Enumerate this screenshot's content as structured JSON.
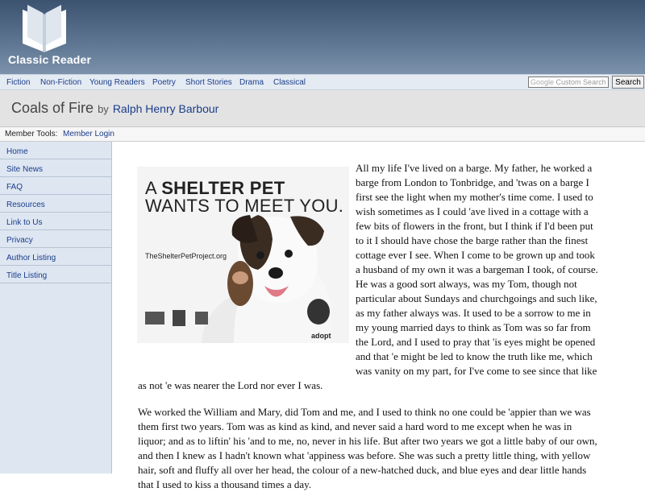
{
  "site": {
    "name": "Classic Reader"
  },
  "nav": {
    "items": [
      "Fiction",
      "Non-Fiction",
      "Young Readers",
      "Poetry",
      "Short Stories",
      "Drama",
      "Classical"
    ],
    "search_placeholder": "Custom Search",
    "search_brand": "Google",
    "search_button": "Search"
  },
  "book": {
    "title": "Coals of Fire",
    "by": "by",
    "author": "Ralph Henry Barbour"
  },
  "member": {
    "label": "Member Tools:",
    "login": "Member Login"
  },
  "sidebar": {
    "items": [
      "Home",
      "Site News",
      "FAQ",
      "Resources",
      "Link to Us",
      "Privacy",
      "Author Listing",
      "Title Listing"
    ]
  },
  "ad": {
    "line1_prefix": "A",
    "line1_bold": "SHELTER PET",
    "line2": "WANTS TO MEET YOU.",
    "url": "TheShelterPetProject.org",
    "adopt": "adopt",
    "council": "Ad Council"
  },
  "text": {
    "wrapped_lines": [
      "All my life I've lived on a barge. My father, he worked a",
      "barge from London to Tonbridge, and 'twas on a barge I",
      "first see the light when my mother's time come. I used to",
      "wish sometimes as I could 'ave lived in a cottage with a",
      "few bits of flowers in the front, but I think if I'd been put",
      "to it I should have chose the barge rather than the finest",
      "cottage ever I see. When I come to be grown up and took",
      "a husband of my own it was a bargeman I took, of course.",
      "He was a good sort always, was my Tom, though not",
      "particular about Sundays and churchgoings and such like,",
      "as my father always was. It used to be a sorrow to me in",
      "my young married days to think as Tom was so far from",
      "the Lord, and I used to pray that 'is eyes might be opened",
      "and that 'e might be led to know the truth like me, which",
      "was vanity on my part, for I've come to see since that like"
    ],
    "line_full": "as not 'e was nearer the Lord nor ever I was.",
    "para2_lines": [
      "We worked the William and Mary, did Tom and me, and I used to think no one could be 'appier than we was",
      "them first two years. Tom was as kind as kind, and never said a hard word to me except when he was in",
      "liquor; and as to liftin' his 'and to me, no, never in his life. But after two years we got a little baby of our own,",
      "and then I knew as I hadn't known what 'appiness was before. She was such a pretty little thing, with yellow",
      "hair, soft and fluffy all over her head, the colour of a new-hatched duck, and blue eyes and dear little hands",
      "that I used to kiss a thousand times a day."
    ]
  }
}
